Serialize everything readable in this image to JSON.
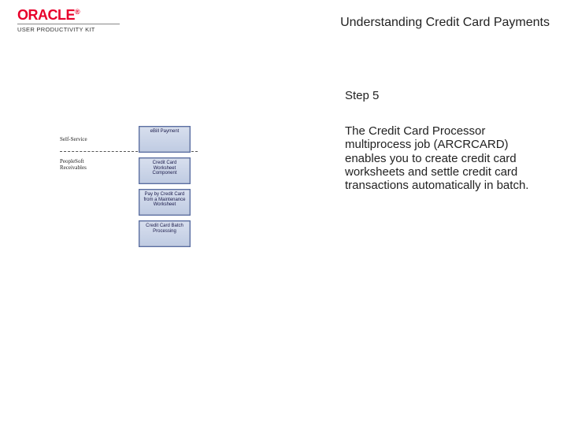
{
  "branding": {
    "logo_text": "ORACLE",
    "logo_reg": "®",
    "product_line": "USER PRODUCTIVITY KIT"
  },
  "header": {
    "title": "Understanding Credit Card Payments"
  },
  "step": {
    "label": "Step 5",
    "body": "The Credit Card Processor multiprocess job (ARCRCARD) enables you to create credit card worksheets and settle credit card transactions automatically in batch."
  },
  "diagram": {
    "lane_labels": {
      "l1": "Self-Service",
      "l2": "PeopleSoft\nReceivables"
    },
    "boxes": {
      "b1": "eBill Payment",
      "b2": "Credit Card Worksheet Component",
      "b3": "Pay by Credit Card from a Maintenance Worksheet",
      "b4": "Credit Card Batch Processing"
    }
  }
}
